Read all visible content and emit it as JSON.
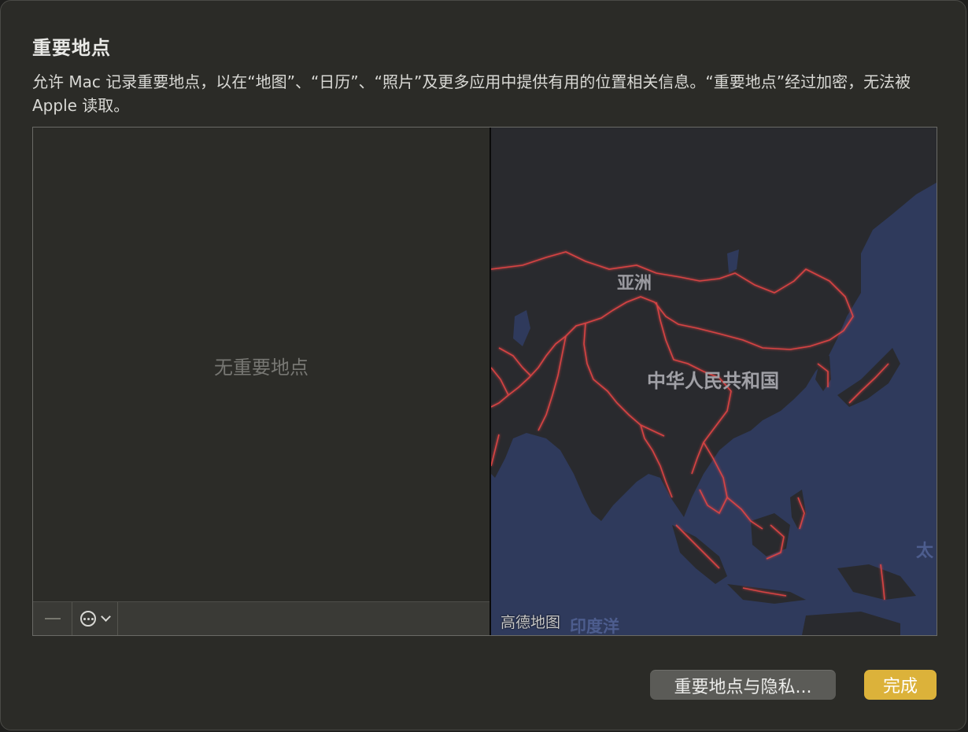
{
  "sheet": {
    "title": "重要地点",
    "description": "允许 Mac 记录重要地点，以在“地图”、“日历”、“照片”及更多应用中提供有用的位置相关信息。“重要地点”经过加密，无法被 Apple 读取。"
  },
  "locations_list": {
    "empty_text": "无重要地点",
    "toolbar": {
      "remove_icon": "minus-icon",
      "more_icon": "ellipsis-circle-icon",
      "dropdown_icon": "chevron-down-icon"
    }
  },
  "map": {
    "labels": {
      "asia": "亚洲",
      "china": "中华人民共和国",
      "indian_ocean": "印度洋",
      "pacific": "太",
      "attribution": "高德地图"
    },
    "colors": {
      "ocean": "#2f3a5c",
      "land": "#292a2e",
      "border": "#e04545"
    }
  },
  "footer": {
    "privacy_button": "重要地点与隐私...",
    "done_button": "完成"
  },
  "colors": {
    "accent": "#dcb23a",
    "panel": "#2b2b27"
  }
}
